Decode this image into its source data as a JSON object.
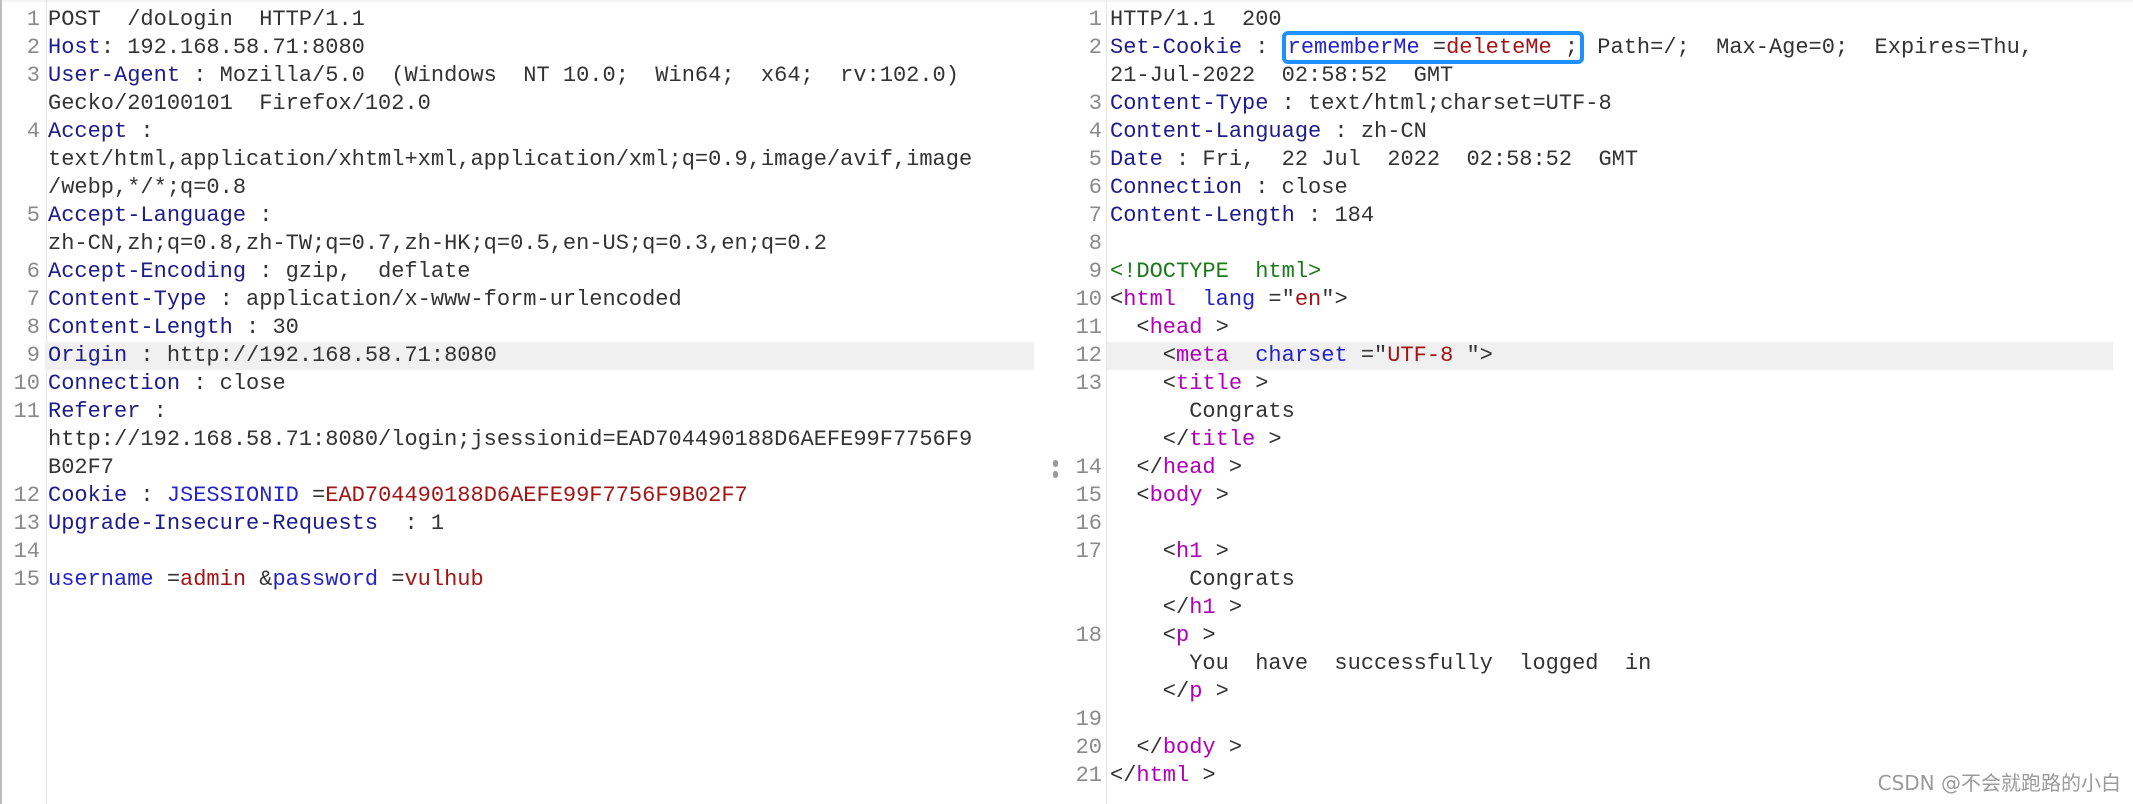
{
  "colors": {
    "header_name": "#1c1c8c",
    "param": "#2424c8",
    "value_red": "#a31515",
    "tag": "#b000b8",
    "doctype": "#1a7a1a",
    "highlight_box": "#1e90ff",
    "current_line": "#f0f0f0"
  },
  "request": {
    "highlight_line": 9,
    "lines": [
      {
        "n": "1",
        "rows": [
          [
            {
              "c": "v",
              "t": "POST  /doLogin  HTTP/1.1"
            }
          ]
        ]
      },
      {
        "n": "2",
        "rows": [
          [
            {
              "c": "k",
              "t": "Host"
            },
            {
              "c": "v",
              "t": ": 192.168.58.71:8080"
            }
          ]
        ]
      },
      {
        "n": "3",
        "rows": [
          [
            {
              "c": "k",
              "t": "User-Agent"
            },
            {
              "c": "v",
              "t": " : Mozilla/5.0  (Windows  NT 10.0;  Win64;  x64;  rv:102.0)"
            }
          ],
          [
            {
              "c": "v",
              "t": "Gecko/20100101  Firefox/102.0"
            }
          ]
        ]
      },
      {
        "n": "4",
        "rows": [
          [
            {
              "c": "k",
              "t": "Accept"
            },
            {
              "c": "v",
              "t": " :"
            }
          ],
          [
            {
              "c": "v",
              "t": "text/html,application/xhtml+xml,application/xml;q=0.9,image/avif,image"
            }
          ],
          [
            {
              "c": "v",
              "t": "/webp,*/*;q=0.8"
            }
          ]
        ]
      },
      {
        "n": "5",
        "rows": [
          [
            {
              "c": "k",
              "t": "Accept-Language"
            },
            {
              "c": "v",
              "t": " :"
            }
          ],
          [
            {
              "c": "v",
              "t": "zh-CN,zh;q=0.8,zh-TW;q=0.7,zh-HK;q=0.5,en-US;q=0.3,en;q=0.2"
            }
          ]
        ]
      },
      {
        "n": "6",
        "rows": [
          [
            {
              "c": "k",
              "t": "Accept-Encoding"
            },
            {
              "c": "v",
              "t": " : gzip,  deflate"
            }
          ]
        ]
      },
      {
        "n": "7",
        "rows": [
          [
            {
              "c": "k",
              "t": "Content-Type"
            },
            {
              "c": "v",
              "t": " : application/x-www-form-urlencoded"
            }
          ]
        ]
      },
      {
        "n": "8",
        "rows": [
          [
            {
              "c": "k",
              "t": "Content-Length"
            },
            {
              "c": "v",
              "t": " : 30"
            }
          ]
        ]
      },
      {
        "n": "9",
        "rows": [
          [
            {
              "c": "k",
              "t": "Origin"
            },
            {
              "c": "v",
              "t": " : http://192.168.58.71:8080"
            }
          ]
        ]
      },
      {
        "n": "10",
        "rows": [
          [
            {
              "c": "k",
              "t": "Connection"
            },
            {
              "c": "v",
              "t": " : close"
            }
          ]
        ]
      },
      {
        "n": "11",
        "rows": [
          [
            {
              "c": "k",
              "t": "Referer"
            },
            {
              "c": "v",
              "t": " :"
            }
          ],
          [
            {
              "c": "v",
              "t": "http://192.168.58.71:8080/login;jsessionid=EAD704490188D6AEFE99F7756F9"
            }
          ],
          [
            {
              "c": "v",
              "t": "B02F7"
            }
          ]
        ]
      },
      {
        "n": "12",
        "rows": [
          [
            {
              "c": "k",
              "t": "Cookie"
            },
            {
              "c": "v",
              "t": " : "
            },
            {
              "c": "p",
              "t": "JSESSIONID"
            },
            {
              "c": "v",
              "t": " ="
            },
            {
              "c": "r",
              "t": "EAD704490188D6AEFE99F7756F9B02F7"
            }
          ]
        ]
      },
      {
        "n": "13",
        "rows": [
          [
            {
              "c": "k",
              "t": "Upgrade-Insecure-Requests"
            },
            {
              "c": "v",
              "t": "  : 1"
            }
          ]
        ]
      },
      {
        "n": "14",
        "rows": [
          []
        ]
      },
      {
        "n": "15",
        "rows": [
          [
            {
              "c": "p",
              "t": "username"
            },
            {
              "c": "v",
              "t": " ="
            },
            {
              "c": "r",
              "t": "admin"
            },
            {
              "c": "v",
              "t": " &"
            },
            {
              "c": "p",
              "t": "password"
            },
            {
              "c": "v",
              "t": " ="
            },
            {
              "c": "r",
              "t": "vulhub"
            }
          ]
        ]
      }
    ]
  },
  "response": {
    "highlight_line": 12,
    "lines": [
      {
        "n": "1",
        "rows": [
          [
            {
              "c": "v",
              "t": "HTTP/1.1  200"
            }
          ]
        ]
      },
      {
        "n": "2",
        "rows": [
          [
            {
              "c": "k",
              "t": "Set-Cookie"
            },
            {
              "c": "v",
              "t": " : "
            },
            {
              "c": "p box-start",
              "t": "rememberMe"
            },
            {
              "c": "v",
              "t": " ="
            },
            {
              "c": "r",
              "t": "deleteMe"
            },
            {
              "c": "v box-end",
              "t": " ;"
            },
            {
              "c": "v",
              "t": " Path=/;  Max-Age=0;  Expires=Thu,"
            }
          ],
          [
            {
              "c": "v",
              "t": "21-Jul-2022  02:58:52  GMT"
            }
          ]
        ]
      },
      {
        "n": "3",
        "rows": [
          [
            {
              "c": "k",
              "t": "Content-Type"
            },
            {
              "c": "v",
              "t": " : text/html;charset=UTF-8"
            }
          ]
        ]
      },
      {
        "n": "4",
        "rows": [
          [
            {
              "c": "k",
              "t": "Content-Language"
            },
            {
              "c": "v",
              "t": " : zh-CN"
            }
          ]
        ]
      },
      {
        "n": "5",
        "rows": [
          [
            {
              "c": "k",
              "t": "Date"
            },
            {
              "c": "v",
              "t": " : Fri,  22 Jul  2022  02:58:52  GMT"
            }
          ]
        ]
      },
      {
        "n": "6",
        "rows": [
          [
            {
              "c": "k",
              "t": "Connection"
            },
            {
              "c": "v",
              "t": " : close"
            }
          ]
        ]
      },
      {
        "n": "7",
        "rows": [
          [
            {
              "c": "k",
              "t": "Content-Length"
            },
            {
              "c": "v",
              "t": " : 184"
            }
          ]
        ]
      },
      {
        "n": "8",
        "rows": [
          []
        ]
      },
      {
        "n": "9",
        "rows": [
          [
            {
              "c": "g",
              "t": "<!DOCTYPE  html>"
            }
          ]
        ]
      },
      {
        "n": "10",
        "rows": [
          [
            {
              "c": "v",
              "t": "<"
            },
            {
              "c": "t",
              "t": "html"
            },
            {
              "c": "v",
              "t": "  "
            },
            {
              "c": "a",
              "t": "lang"
            },
            {
              "c": "v",
              "t": " =\""
            },
            {
              "c": "r",
              "t": "en"
            },
            {
              "c": "v",
              "t": "\">"
            }
          ]
        ]
      },
      {
        "n": "11",
        "rows": [
          [
            {
              "c": "v",
              "t": "  <"
            },
            {
              "c": "t",
              "t": "head"
            },
            {
              "c": "v",
              "t": " >"
            }
          ]
        ]
      },
      {
        "n": "12",
        "rows": [
          [
            {
              "c": "v",
              "t": "    <"
            },
            {
              "c": "t",
              "t": "meta"
            },
            {
              "c": "v",
              "t": "  "
            },
            {
              "c": "a",
              "t": "charset"
            },
            {
              "c": "v",
              "t": " =\""
            },
            {
              "c": "r",
              "t": "UTF-8"
            },
            {
              "c": "v",
              "t": " \">"
            }
          ]
        ]
      },
      {
        "n": "13",
        "rows": [
          [
            {
              "c": "v",
              "t": "    <"
            },
            {
              "c": "t",
              "t": "title"
            },
            {
              "c": "v",
              "t": " >"
            }
          ],
          [
            {
              "c": "v",
              "t": "      Congrats"
            }
          ],
          [
            {
              "c": "v",
              "t": "    </"
            },
            {
              "c": "t",
              "t": "title"
            },
            {
              "c": "v",
              "t": " >"
            }
          ]
        ]
      },
      {
        "n": "14",
        "rows": [
          [
            {
              "c": "v",
              "t": "  </"
            },
            {
              "c": "t",
              "t": "head"
            },
            {
              "c": "v",
              "t": " >"
            }
          ]
        ]
      },
      {
        "n": "15",
        "rows": [
          [
            {
              "c": "v",
              "t": "  <"
            },
            {
              "c": "t",
              "t": "body"
            },
            {
              "c": "v",
              "t": " >"
            }
          ]
        ]
      },
      {
        "n": "16",
        "rows": [
          []
        ]
      },
      {
        "n": "17",
        "rows": [
          [
            {
              "c": "v",
              "t": "    <"
            },
            {
              "c": "t",
              "t": "h1"
            },
            {
              "c": "v",
              "t": " >"
            }
          ],
          [
            {
              "c": "v",
              "t": "      Congrats"
            }
          ],
          [
            {
              "c": "v",
              "t": "    </"
            },
            {
              "c": "t",
              "t": "h1"
            },
            {
              "c": "v",
              "t": " >"
            }
          ]
        ]
      },
      {
        "n": "18",
        "rows": [
          [
            {
              "c": "v",
              "t": "    <"
            },
            {
              "c": "t",
              "t": "p"
            },
            {
              "c": "v",
              "t": " >"
            }
          ],
          [
            {
              "c": "v",
              "t": "      You  have  successfully  logged  in"
            }
          ],
          [
            {
              "c": "v",
              "t": "    </"
            },
            {
              "c": "t",
              "t": "p"
            },
            {
              "c": "v",
              "t": " >"
            }
          ]
        ]
      },
      {
        "n": "19",
        "rows": [
          []
        ]
      },
      {
        "n": "20",
        "rows": [
          [
            {
              "c": "v",
              "t": "  </"
            },
            {
              "c": "t",
              "t": "body"
            },
            {
              "c": "v",
              "t": " >"
            }
          ]
        ]
      },
      {
        "n": "21",
        "rows": [
          [
            {
              "c": "v",
              "t": "</"
            },
            {
              "c": "t",
              "t": "html"
            },
            {
              "c": "v",
              "t": " >"
            }
          ]
        ]
      }
    ]
  },
  "watermark": "CSDN @不会就跑路的小白"
}
